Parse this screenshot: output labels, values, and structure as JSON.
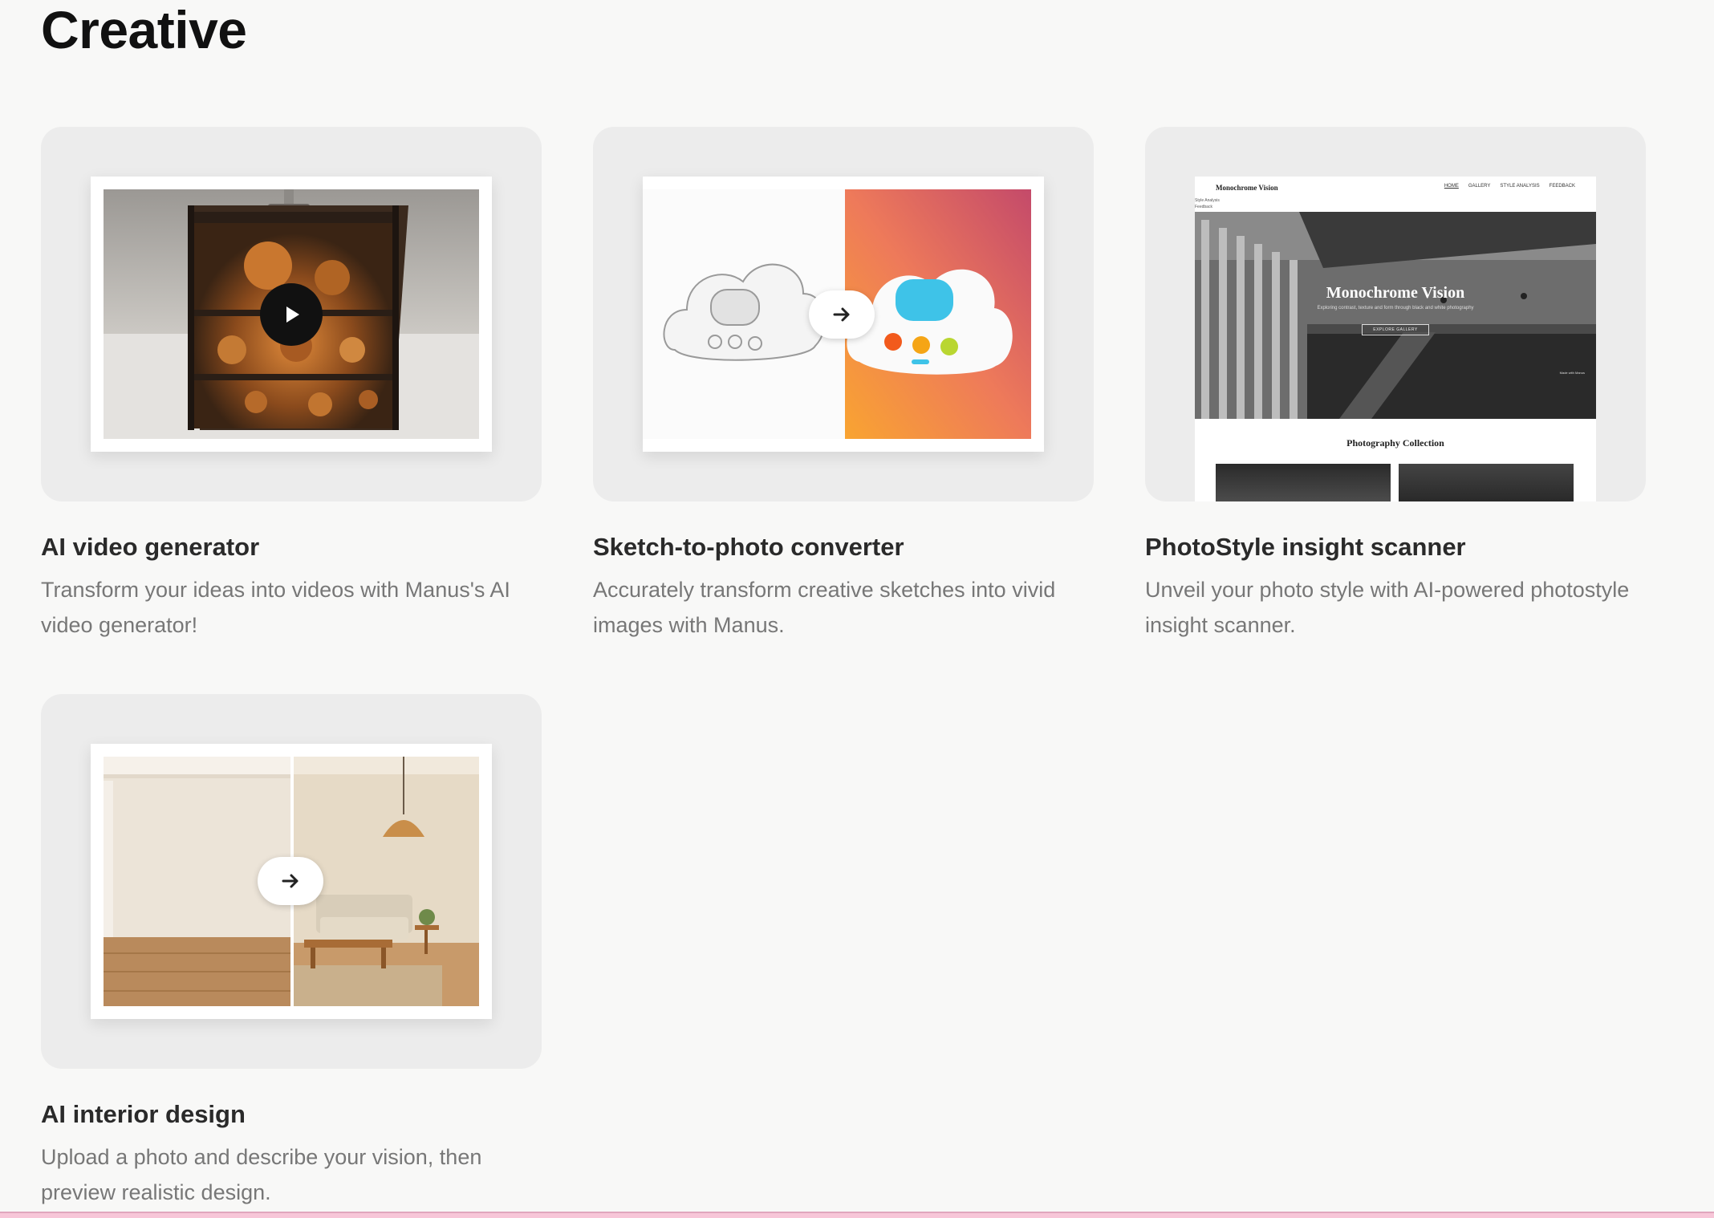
{
  "section": {
    "title": "Creative"
  },
  "cards": [
    {
      "title": "AI video generator",
      "description": "Transform your ideas into videos with Manus's AI video generator!"
    },
    {
      "title": "Sketch-to-photo converter",
      "description": "Accurately transform creative sketches into vivid images with Manus."
    },
    {
      "title": "PhotoStyle insight scanner",
      "description": "Unveil your photo style with AI-powered photostyle insight scanner.",
      "preview": {
        "brand": "Monochrome Vision",
        "nav": [
          "HOME",
          "GALLERY",
          "STYLE ANALYSIS",
          "FEEDBACK"
        ],
        "side": [
          "Style Analysis",
          "Feedback"
        ],
        "hero_title": "Monochrome Vision",
        "hero_subtitle": "Exploring contrast, texture and form through black and white photography",
        "hero_button": "EXPLORE GALLERY",
        "badge": "Made with Manus",
        "section_title": "Photography Collection"
      }
    },
    {
      "title": "AI interior design",
      "description": "Upload a photo and describe your vision, then preview realistic design."
    }
  ],
  "icons": {
    "play": "play-icon",
    "arrow": "arrow-right-icon"
  },
  "colors": {
    "background": "#f8f8f7",
    "card_bg": "#ececec",
    "title": "#111111",
    "description": "#777777"
  }
}
